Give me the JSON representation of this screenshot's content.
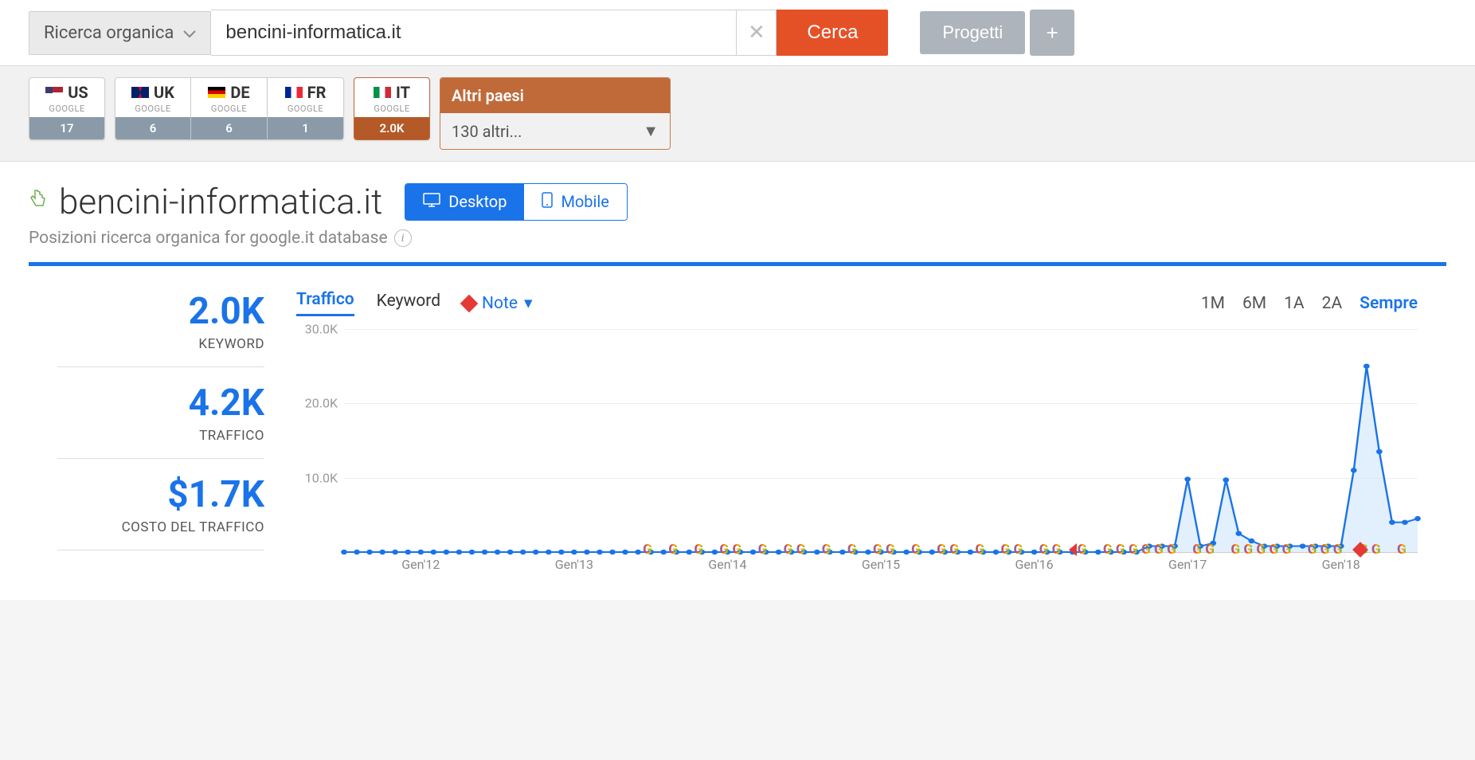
{
  "search": {
    "type_label": "Ricerca organica",
    "input_value": "bencini-informatica.it",
    "button_label": "Cerca",
    "projects_label": "Progetti",
    "plus_label": "+"
  },
  "countries": {
    "items": [
      {
        "code": "US",
        "sub": "GOOGLE",
        "count": "17",
        "flag": "flag-us"
      },
      {
        "code": "UK",
        "sub": "GOOGLE",
        "count": "6",
        "flag": "flag-uk"
      },
      {
        "code": "DE",
        "sub": "GOOGLE",
        "count": "6",
        "flag": "flag-de"
      },
      {
        "code": "FR",
        "sub": "GOOGLE",
        "count": "1",
        "flag": "flag-fr"
      }
    ],
    "active": {
      "code": "IT",
      "sub": "GOOGLE",
      "count": "2.0K",
      "flag": "flag-it"
    },
    "other_header": "Altri paesi",
    "other_selected": "130 altri..."
  },
  "header": {
    "domain": "bencini-informatica.it",
    "device_desktop": "Desktop",
    "device_mobile": "Mobile",
    "subtitle": "Posizioni ricerca organica for google.it database"
  },
  "stats": [
    {
      "value": "2.0K",
      "label": "KEYWORD"
    },
    {
      "value": "4.2K",
      "label": "TRAFFICO"
    },
    {
      "value": "$1.7K",
      "label": "COSTO DEL TRAFFICO"
    }
  ],
  "chart_tabs": {
    "traffic": "Traffico",
    "keyword": "Keyword",
    "note": "Note",
    "ranges": [
      "1M",
      "6M",
      "1A",
      "2A",
      "Sempre"
    ],
    "active_range": "Sempre"
  },
  "chart_data": {
    "type": "line",
    "title": "",
    "xlabel": "",
    "ylabel": "",
    "ylim": [
      0,
      30000
    ],
    "yticks": [
      "10.0K",
      "20.0K",
      "30.0K"
    ],
    "xticks": [
      "Gen'12",
      "Gen'13",
      "Gen'14",
      "Gen'15",
      "Gen'16",
      "Gen'17",
      "Gen'18"
    ],
    "x": [
      0,
      1,
      2,
      3,
      4,
      5,
      6,
      7,
      8,
      9,
      10,
      11,
      12,
      13,
      14,
      15,
      16,
      17,
      18,
      19,
      20,
      21,
      22,
      23,
      24,
      25,
      26,
      27,
      28,
      29,
      30,
      31,
      32,
      33,
      34,
      35,
      36,
      37,
      38,
      39,
      40,
      41,
      42,
      43,
      44,
      45,
      46,
      47,
      48,
      49,
      50,
      51,
      52,
      53,
      54,
      55,
      56,
      57,
      58,
      59,
      60,
      61,
      62,
      63,
      64,
      65,
      66,
      67,
      68,
      69,
      70,
      71,
      72,
      73,
      74,
      75,
      76,
      77,
      78,
      79,
      80,
      81,
      82,
      83,
      84
    ],
    "values": [
      0,
      0,
      0,
      0,
      0,
      0,
      0,
      0,
      0,
      0,
      0,
      0,
      0,
      0,
      0,
      0,
      0,
      0,
      0,
      0,
      0,
      0,
      0,
      0,
      0,
      0,
      0,
      0,
      0,
      0,
      0,
      0,
      0,
      0,
      0,
      0,
      0,
      0,
      0,
      0,
      0,
      0,
      0,
      0,
      0,
      0,
      0,
      0,
      0,
      0,
      0,
      0,
      0,
      0,
      0,
      0,
      0,
      0,
      0,
      0,
      0,
      0,
      0,
      800,
      800,
      800,
      9800,
      800,
      1200,
      9700,
      2500,
      1500,
      800,
      800,
      800,
      800,
      800,
      800,
      800,
      11000,
      25000,
      13500,
      4000,
      4000,
      4500
    ],
    "xrange": [
      0,
      84
    ],
    "g_markers": [
      24,
      26,
      28,
      30,
      31,
      33,
      35,
      36,
      38,
      40,
      42,
      43,
      45,
      47,
      48,
      50,
      52,
      53,
      55,
      56,
      58,
      60,
      61,
      62,
      63,
      64,
      65,
      67,
      68,
      70,
      71,
      72,
      73,
      74,
      76,
      77,
      78,
      80,
      81,
      83
    ],
    "note_markers": [
      79.5
    ],
    "left_arrows": [
      57
    ]
  }
}
